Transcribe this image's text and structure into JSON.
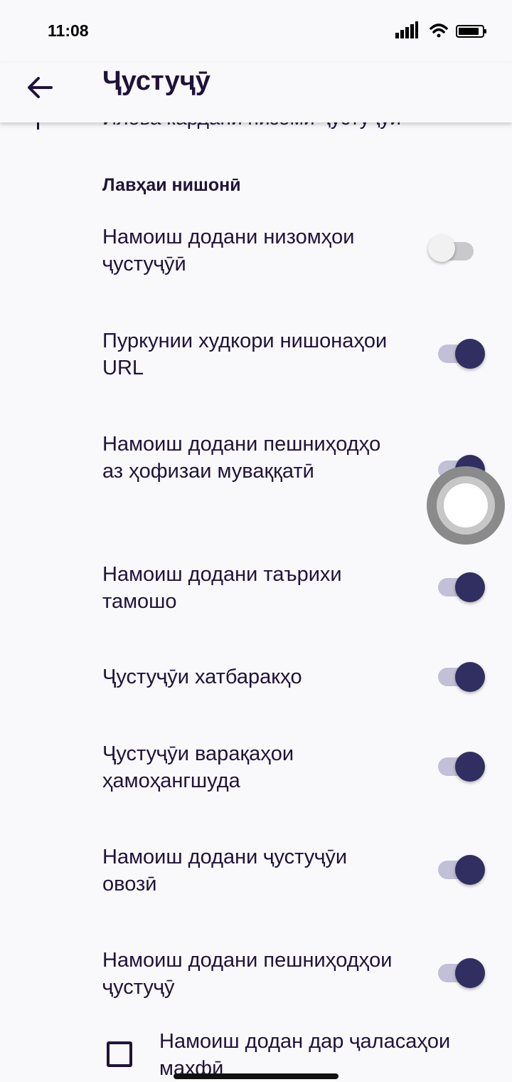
{
  "status_bar": {
    "time": "11:08"
  },
  "app_bar": {
    "title": "Ҷустуҷӯ"
  },
  "partial_row_label": "Илова кардани низоми ҷустуҷӯи",
  "section": {
    "title": "Лавҳаи нишонӣ",
    "items": [
      {
        "label": "Намоиш додани низомҳои ҷустуҷӯӣ",
        "checked": false
      },
      {
        "label": "Пуркунии худкори нишонаҳои URL",
        "checked": true
      },
      {
        "label": "Намоиш додани пешниҳодҳо аз ҳофизаи муваққатӣ",
        "checked": true
      },
      {
        "label": "Намоиш додани таърихи тамошо",
        "checked": true
      },
      {
        "label": "Ҷустуҷӯи хатбаракҳо",
        "checked": true
      },
      {
        "label": "Ҷустуҷӯи варақаҳои ҳамоҳангшуда",
        "checked": true
      },
      {
        "label": "Намоиш додани ҷустуҷӯи овозӣ",
        "checked": true
      },
      {
        "label": "Намоиш додани пешниҳодҳои ҷустуҷӯ",
        "checked": true
      }
    ]
  },
  "private_checkbox": {
    "label": "Намоиш додан дар ҷаласаҳои махфӣ",
    "checked": false
  },
  "colors": {
    "accent": "#312e61",
    "text": "#20123a",
    "background": "#f9f9fb"
  }
}
